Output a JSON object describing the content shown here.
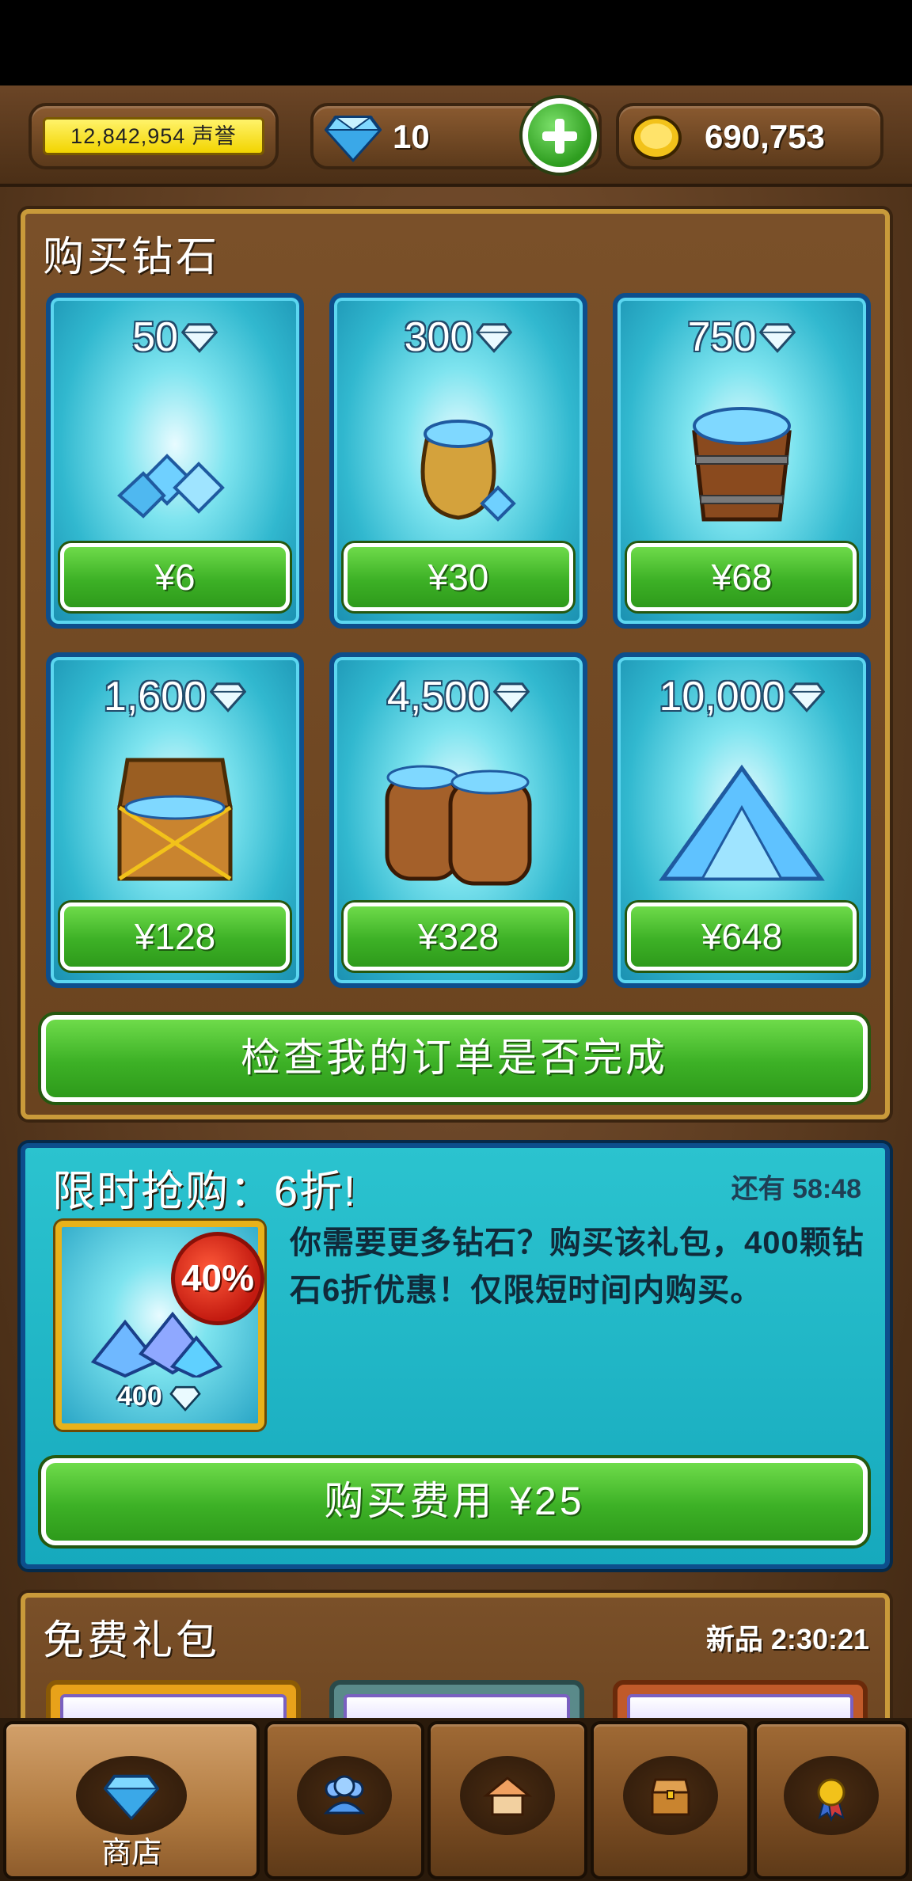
{
  "hud": {
    "reputation": "12,842,954 声誉",
    "gems": "10",
    "gold": "690,753"
  },
  "shop": {
    "title": "购买钻石",
    "packs": [
      {
        "amount": "50",
        "price": "¥6",
        "art": "gem-pile-small"
      },
      {
        "amount": "300",
        "price": "¥30",
        "art": "gem-sack"
      },
      {
        "amount": "750",
        "price": "¥68",
        "art": "gem-bucket"
      },
      {
        "amount": "1,600",
        "price": "¥128",
        "art": "gem-chest"
      },
      {
        "amount": "4,500",
        "price": "¥328",
        "art": "gem-barrels"
      },
      {
        "amount": "10,000",
        "price": "¥648",
        "art": "gem-mountain"
      }
    ],
    "check_order_label": "检查我的订单是否完成"
  },
  "deal": {
    "title": "限时抢购：6折!",
    "timer": "还有 58:48",
    "badge": "40%",
    "count": "400",
    "description": "你需要更多钻石？购买该礼包，400颗钻石6折优惠！仅限短时间内购买。",
    "buy_label": "购买费用 ¥25"
  },
  "free": {
    "title": "免费礼包",
    "timer": "新品 2:30:21"
  },
  "nav": {
    "tabs": [
      {
        "label": "商店",
        "icon": "gem-icon",
        "active": true
      },
      {
        "label": "",
        "icon": "people-icon"
      },
      {
        "label": "",
        "icon": "home-icon"
      },
      {
        "label": "",
        "icon": "treasure-chest-icon"
      },
      {
        "label": "",
        "icon": "medal-icon"
      }
    ]
  },
  "colors": {
    "accent_green": "#3db126",
    "teal_panel": "#16a9bd",
    "wood": "#6a431f",
    "gold_border": "#c99a3a"
  }
}
